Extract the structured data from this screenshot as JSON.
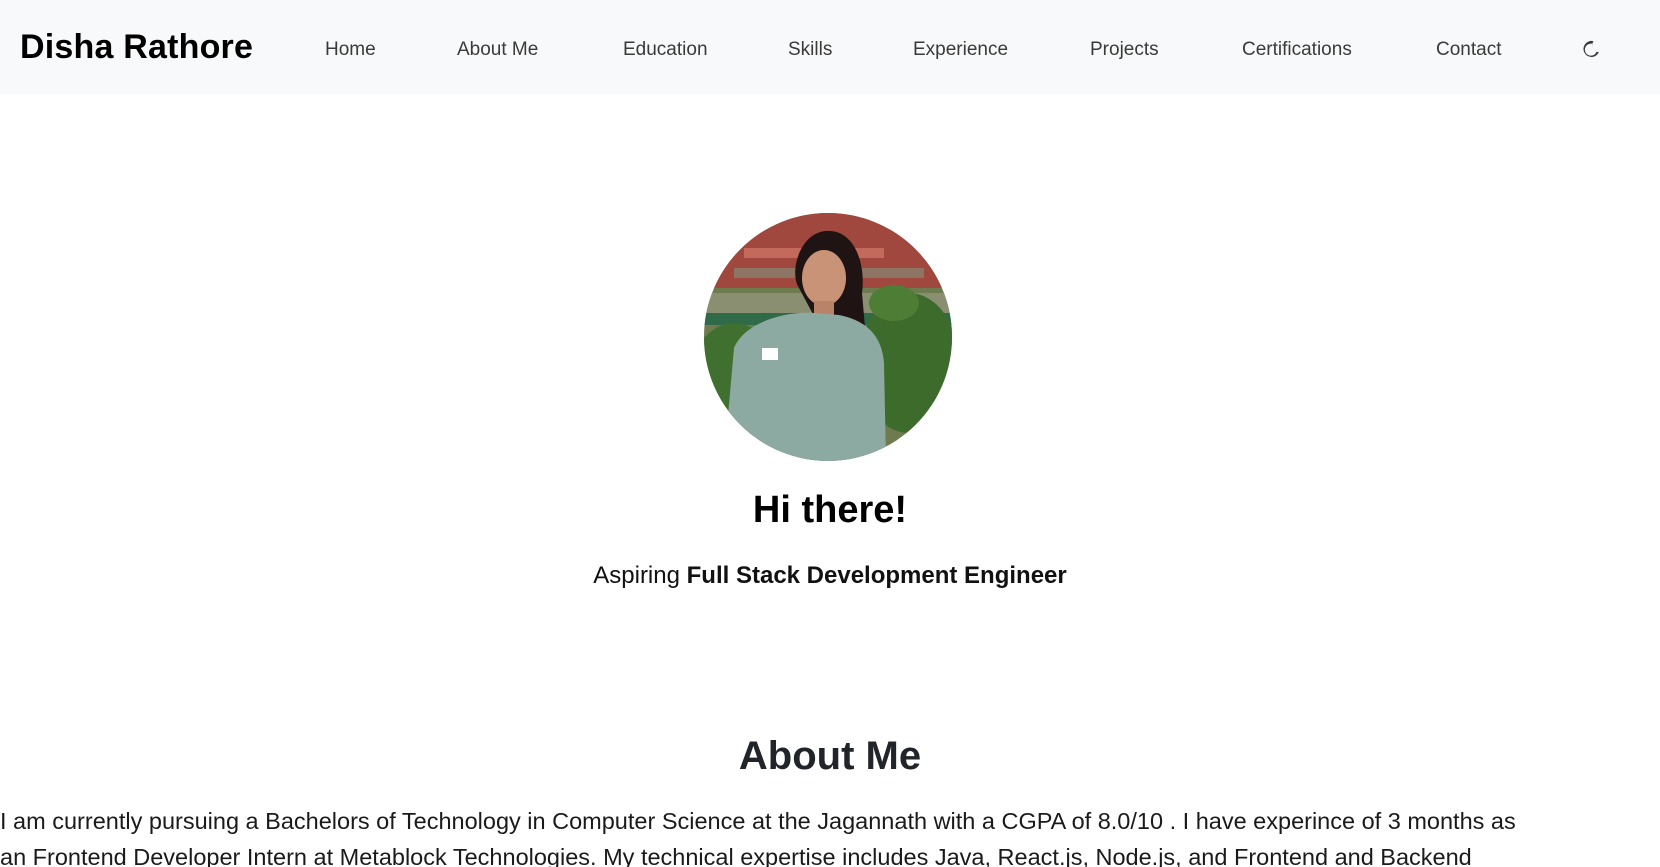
{
  "navbar": {
    "brand": "Disha Rathore",
    "links": [
      "Home",
      "About Me",
      "Education",
      "Skills",
      "Experience",
      "Projects",
      "Certifications",
      "Contact"
    ],
    "theme_toggle_icon": "moon-icon"
  },
  "hero": {
    "greeting": "Hi there!",
    "subtitle_prefix": "Aspiring",
    "subtitle_role": "Full Stack Development Engineer"
  },
  "about": {
    "title": "About Me",
    "line1": "I am currently pursuing a Bachelors of Technology in Computer Science at the Jagannath with a CGPA of 8.0/10 . I have experince of 3 months as",
    "line2": "an Frontend Developer Intern at Metablock Technologies. My technical expertise includes Java, React.js, Node.js, and Frontend and Backend"
  },
  "colors": {
    "navbar_bg": "#f8f9fa",
    "page_bg": "#ffffff",
    "text": "#212529"
  }
}
